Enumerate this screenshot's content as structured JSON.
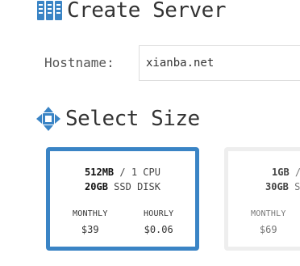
{
  "create_section": {
    "icon": "server-icon",
    "title": "Create Server"
  },
  "hostname": {
    "label": "Hostname:",
    "value": "xianba.net"
  },
  "size_section": {
    "icon": "move-arrows-icon",
    "title": "Select Size"
  },
  "colors": {
    "accent": "#3a84c5",
    "unselected_border": "#eeeeee"
  },
  "plans": [
    {
      "memory": "512MB",
      "cpu": "/ 1 CPU",
      "disk": "20GB",
      "disk_type": "SSD DISK",
      "monthly_label": "MONTHLY",
      "monthly_price": "$39",
      "hourly_label": "HOURLY",
      "hourly_price": "$0.06",
      "selected": true
    },
    {
      "memory": "1GB",
      "cpu": "/",
      "disk": "30GB",
      "disk_type": "S",
      "monthly_label": "MONTHLY",
      "monthly_price": "$69",
      "selected": false
    }
  ]
}
